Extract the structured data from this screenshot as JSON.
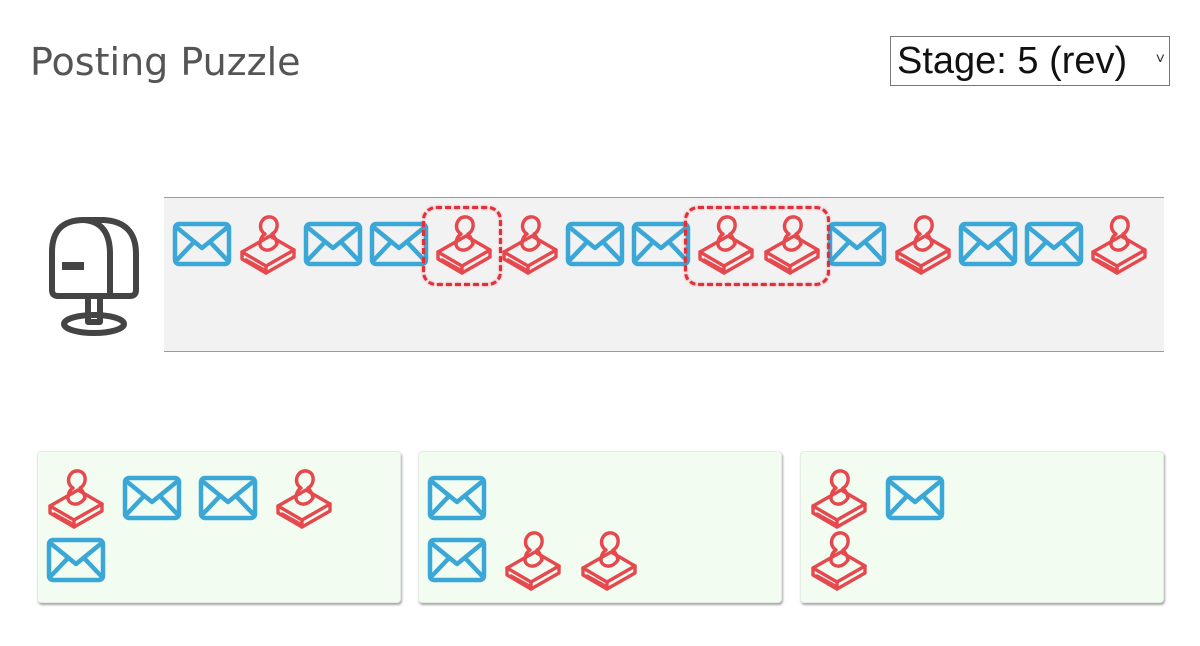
{
  "header": {
    "title": "Posting Puzzle",
    "stage_label": "Stage: 5 (rev)"
  },
  "colors": {
    "letter": "#3aa7d6",
    "stamp": "#e5484d",
    "highlight": "#e0303a",
    "track_background": "#f2f2f2",
    "card_background": "#f2fcf1",
    "mailbox": "#444444"
  },
  "icons": {
    "mailbox": "mailbox-icon",
    "letter": "envelope-icon",
    "stamp": "stamp-icon"
  },
  "sequence": [
    "letter",
    "stamp",
    "letter",
    "letter",
    "stamp",
    "stamp",
    "letter",
    "letter",
    "stamp",
    "stamp",
    "letter",
    "stamp",
    "letter",
    "letter",
    "stamp"
  ],
  "highlighted_groups": [
    [
      4
    ],
    [
      8,
      9
    ]
  ],
  "cards": [
    {
      "rows": [
        [
          "stamp",
          "letter",
          "letter",
          "stamp"
        ],
        [
          "letter"
        ]
      ]
    },
    {
      "rows": [
        [
          "letter"
        ],
        [
          "letter",
          "stamp",
          "stamp"
        ]
      ]
    },
    {
      "rows": [
        [
          "stamp",
          "letter"
        ],
        [
          "stamp"
        ]
      ]
    }
  ]
}
